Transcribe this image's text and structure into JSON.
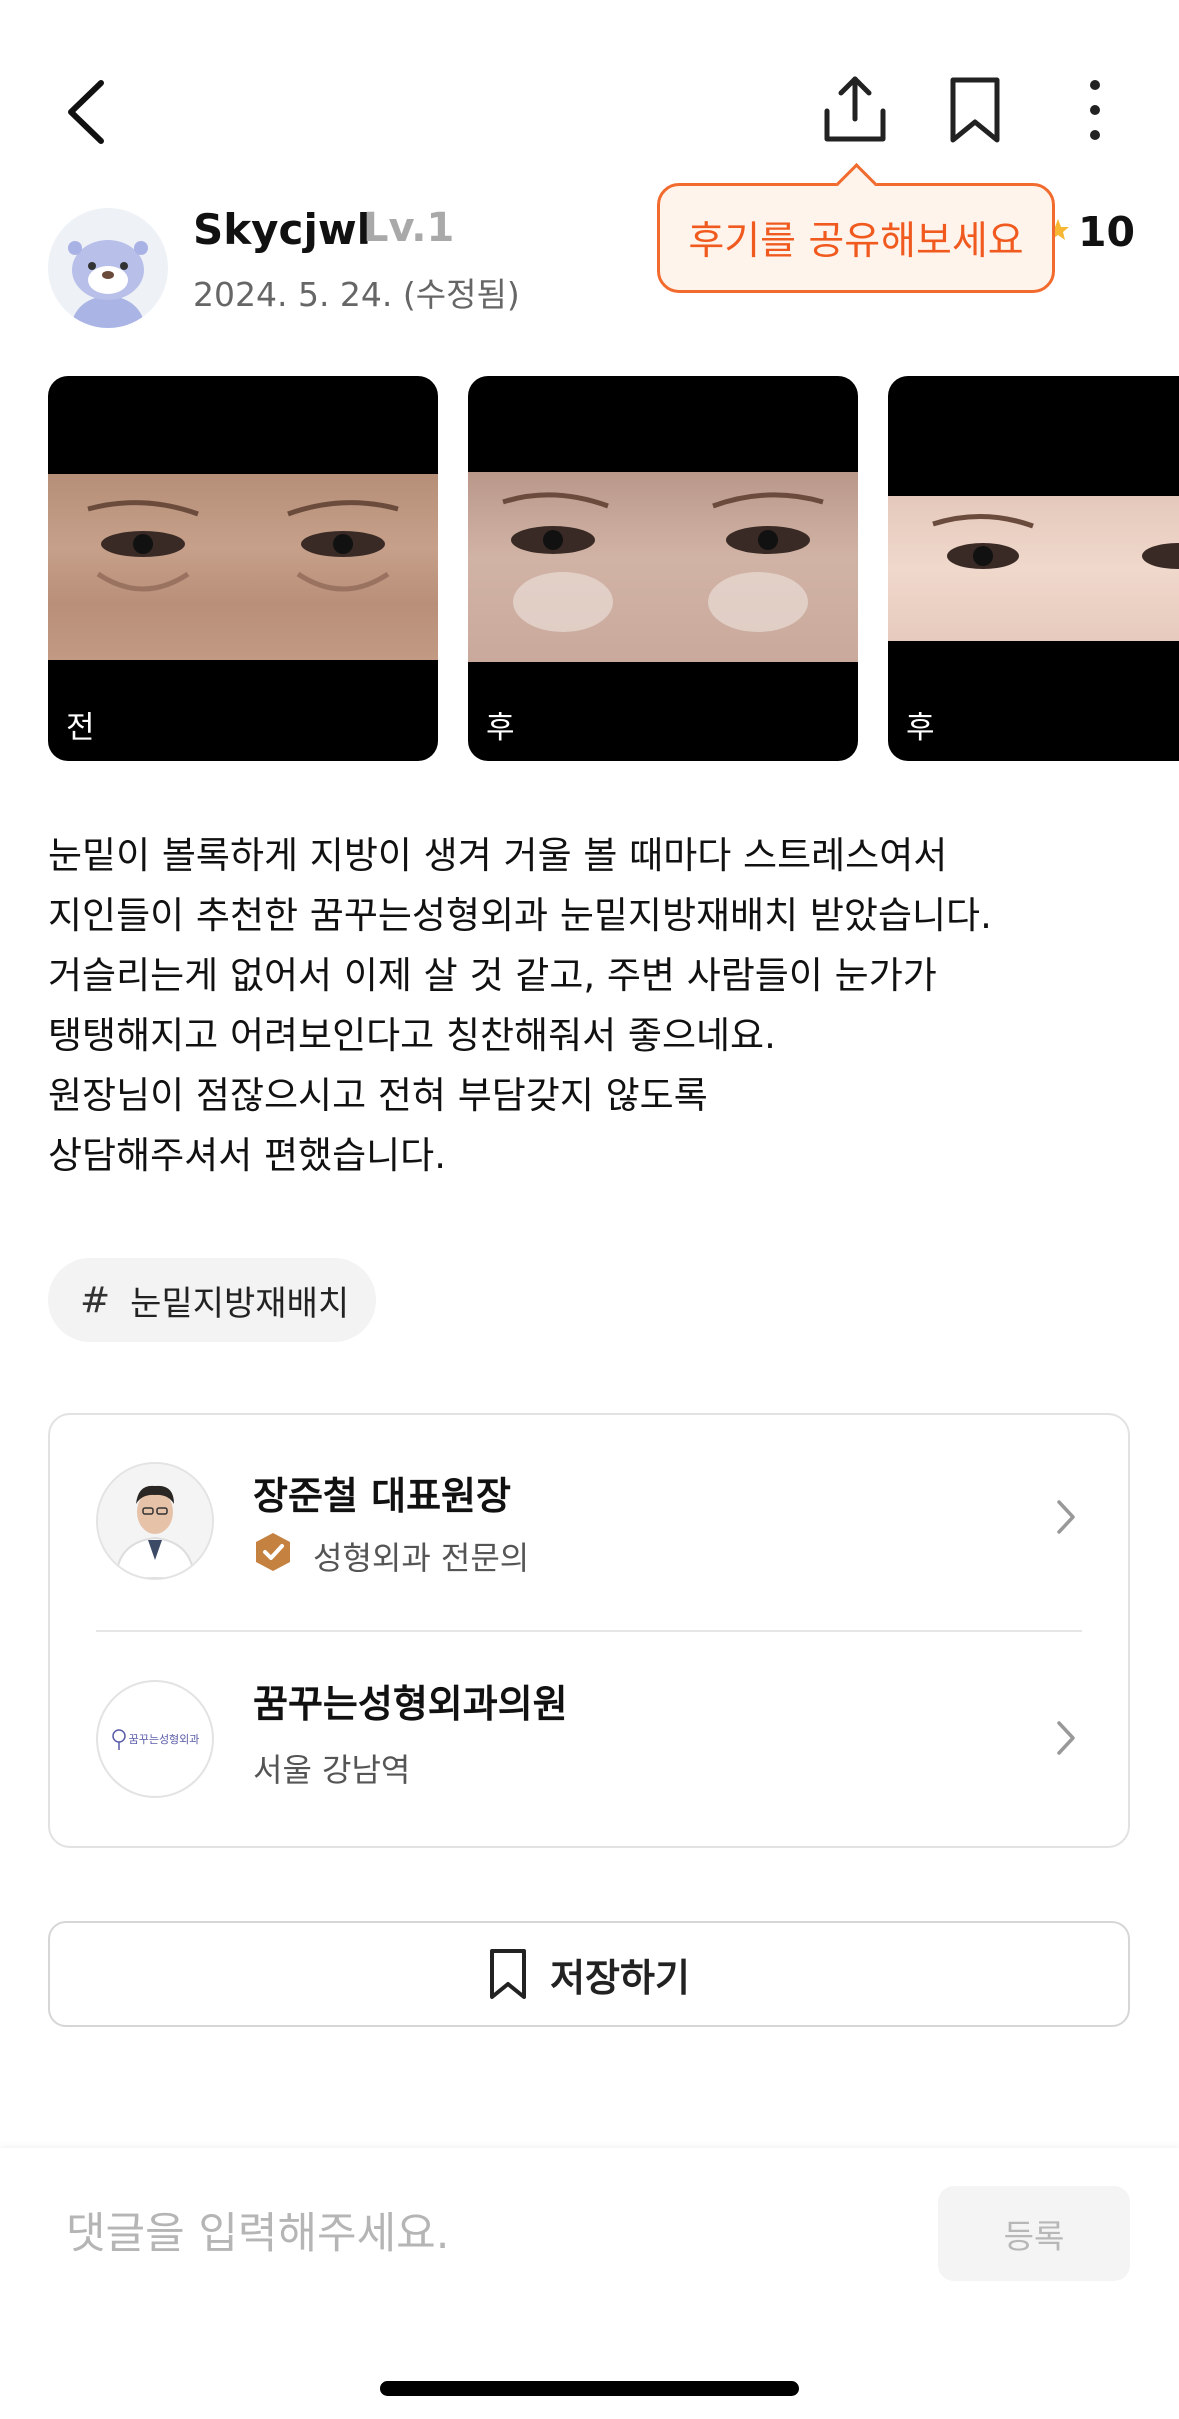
{
  "header": {
    "back_icon": "chevron-left-icon",
    "share_icon": "share-icon",
    "bookmark_icon": "bookmark-icon",
    "more_icon": "more-vertical-icon",
    "share_tooltip": "후기를 공유해보세요"
  },
  "author": {
    "name": "Skycjwl",
    "level": "Lv.1",
    "date": "2024. 5. 24. (수정됨)",
    "rating": "10"
  },
  "photos": [
    {
      "label": "전"
    },
    {
      "label": "후"
    },
    {
      "label": "후"
    }
  ],
  "review": {
    "lines": [
      "눈밑이 볼록하게 지방이 생겨 거울 볼 때마다 스트레스여서",
      "지인들이 추천한 꿈꾸는성형외과 눈밑지방재배치 받았습니다.",
      "거슬리는게 없어서 이제 살 것 같고, 주변 사람들이 눈가가",
      "탱탱해지고 어려보인다고 칭찬해줘서 좋으네요.",
      "원장님이 점잖으시고 전혀 부담갖지 않도록",
      "상담해주셔서 편했습니다."
    ]
  },
  "tag": {
    "hash": "#",
    "label": "눈밑지방재배치"
  },
  "doctor": {
    "name": "장준철 대표원장",
    "specialty": "성형외과 전문의"
  },
  "clinic": {
    "name": "꿈꾸는성형외과의원",
    "location": "서울 강남역",
    "logo_text": "꿈꾸는성형외과"
  },
  "save_button": {
    "label": "저장하기"
  },
  "comment": {
    "placeholder": "댓글을 입력해주세요.",
    "submit_label": "등록"
  },
  "colors": {
    "accent": "#f26b2e",
    "badge": "#c4813f"
  }
}
